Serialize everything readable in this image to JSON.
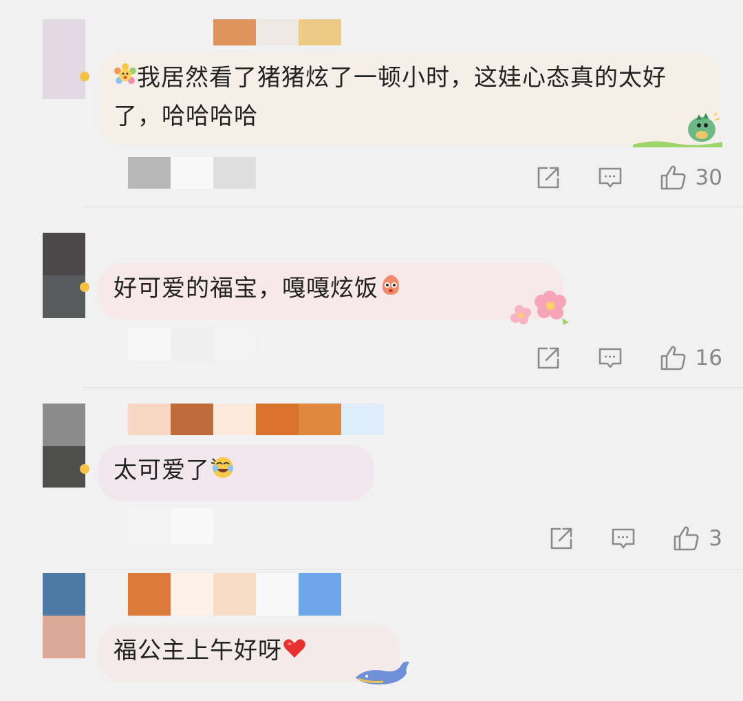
{
  "comments": [
    {
      "text": "我居然看了猪猪炫了一顿小时，这娃心态真的太好了，哈哈哈哈",
      "like_count": "30",
      "bubble_color": "#f6efe7",
      "lead_emoji": "flower-face-emoji",
      "trail_emoji": "",
      "decoration": "green-dinosaur-sticker"
    },
    {
      "text": "好可爱的福宝，嘎嘎炫饭",
      "like_count": "16",
      "bubble_color": "#f7e9ea",
      "lead_emoji": "",
      "trail_emoji": "pink-creature-emoji",
      "decoration": "pink-flowers-sticker"
    },
    {
      "text": "太可爱了",
      "like_count": "3",
      "bubble_color": "#f2e7ec",
      "lead_emoji": "",
      "trail_emoji": "laughing-face-emoji",
      "decoration": ""
    },
    {
      "text": "福公主上午好呀",
      "like_count": "",
      "bubble_color": "#f4eaea",
      "lead_emoji": "",
      "trail_emoji": "red-heart-emoji",
      "decoration": "blue-whale-sticker"
    }
  ],
  "icons": {
    "share": "share-icon",
    "reply": "reply-icon",
    "like": "thumbs-up-icon"
  },
  "colors": {
    "background": "#f1f1f1",
    "icon_gray": "#888888"
  }
}
